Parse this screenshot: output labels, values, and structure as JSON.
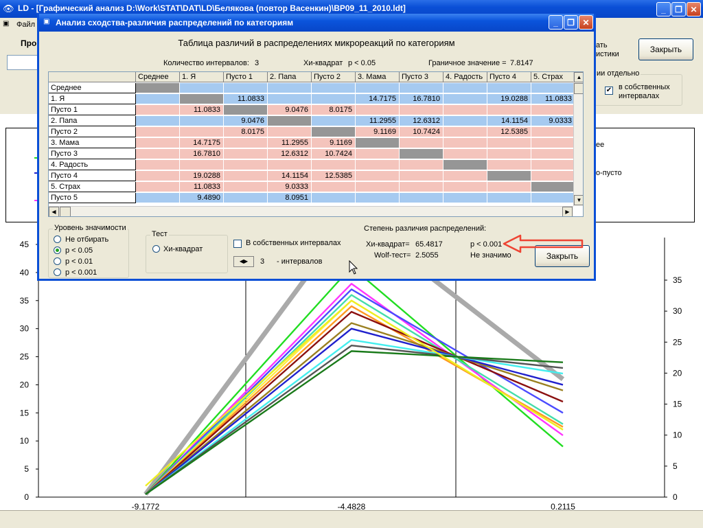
{
  "main": {
    "title": "LD - [Графический анализ D:\\Work\\STAT\\DAT\\LD\\Белякова (повтор Васенкин)\\BP09_11_2010.ldt]",
    "menu_file": "Файл",
    "toolbar_label_pro": "Про",
    "btn_stats_line1": "ать",
    "btn_stats_line2": "истики",
    "close_label": "Закрыть",
    "group_label": "ии отдельно",
    "checkbox_label_1": "в собственных",
    "checkbox_label_2": "интервалах",
    "legend_fragment_1": "ее",
    "legend_fragment_2": "о-пусто"
  },
  "dialog": {
    "title": "Анализ сходства-различия распределений по категориям",
    "table_title": "Таблица различий в распределениях микрореакций по категориям",
    "intervals_label": "Количество интервалов:",
    "intervals_value": "3",
    "chi_label": "Хи-квадрат",
    "chi_p": "p < 0.05",
    "boundary_label": "Граничное значение =",
    "boundary_value": "7.8147",
    "columns": [
      "Среднее",
      "1. Я",
      "Пусто 1",
      "2. Папа",
      "Пусто 2",
      "3. Мама",
      "Пусто 3",
      "4. Радость",
      "Пусто 4",
      "5. Страх"
    ],
    "rows": [
      {
        "label": "Среднее",
        "cells": [
          "",
          "",
          "",
          "",
          "",
          "",
          "",
          "",
          "",
          ""
        ]
      },
      {
        "label": "1. Я",
        "cells": [
          "",
          "",
          "11.0833",
          "",
          "",
          "14.7175",
          "16.7810",
          "",
          "19.0288",
          "11.0833"
        ]
      },
      {
        "label": "Пусто 1",
        "cells": [
          "",
          "11.0833",
          "",
          "9.0476",
          "8.0175",
          "",
          "",
          "",
          "",
          ""
        ]
      },
      {
        "label": "2. Папа",
        "cells": [
          "",
          "",
          "9.0476",
          "",
          "",
          "11.2955",
          "12.6312",
          "",
          "14.1154",
          "9.0333"
        ]
      },
      {
        "label": "Пусто 2",
        "cells": [
          "",
          "",
          "8.0175",
          "",
          "",
          "9.1169",
          "10.7424",
          "",
          "12.5385",
          ""
        ]
      },
      {
        "label": "3. Мама",
        "cells": [
          "",
          "14.7175",
          "",
          "11.2955",
          "9.1169",
          "",
          "",
          "",
          "",
          ""
        ]
      },
      {
        "label": "Пусто 3",
        "cells": [
          "",
          "16.7810",
          "",
          "12.6312",
          "10.7424",
          "",
          "",
          "",
          "",
          ""
        ]
      },
      {
        "label": "4. Радость",
        "cells": [
          "",
          "",
          "",
          "",
          "",
          "",
          "",
          "",
          "",
          ""
        ]
      },
      {
        "label": "Пусто 4",
        "cells": [
          "",
          "19.0288",
          "",
          "14.1154",
          "12.5385",
          "",
          "",
          "",
          "",
          ""
        ]
      },
      {
        "label": "5. Страх",
        "cells": [
          "",
          "11.0833",
          "",
          "9.0333",
          "",
          "",
          "",
          "",
          "",
          ""
        ]
      },
      {
        "label": "Пусто 5",
        "cells": [
          "",
          "9.4890",
          "",
          "8.0951",
          "",
          "",
          "",
          "",
          "",
          ""
        ]
      }
    ],
    "colors": {
      "blue": "#a6caf0",
      "pink": "#f4c4bc",
      "gray": "#969696"
    },
    "significance": {
      "label": "Уровень значимости",
      "options": [
        "Не отбирать",
        "p < 0.05",
        "p < 0.01",
        "p < 0.001"
      ],
      "selected": "p < 0.05"
    },
    "test": {
      "label": "Тест",
      "option": "Хи-квадрат"
    },
    "own_intervals_label": "В собственных интервалах",
    "intervals_stepper_value": "3",
    "intervals_stepper_suffix": "- интервалов",
    "result": {
      "heading": "Степень различия распределений:",
      "chi_label": "Хи-квадрат=",
      "chi_value": "65.4817",
      "chi_p": "p < 0.001",
      "wolf_label": "Wolf-тест=",
      "wolf_value": "2.5055",
      "wolf_p": "Не значимо"
    },
    "close_label": "Закрыть"
  },
  "chart_data": {
    "type": "line",
    "x": [
      -9.1772,
      -4.4828,
      0.2115
    ],
    "x_tick_labels": [
      "-9.1772",
      "-4.4828",
      "0.2115"
    ],
    "y_left_ticks": [
      0,
      5,
      10,
      15,
      20,
      25,
      30,
      35,
      40,
      45
    ],
    "y_right_ticks": [
      0,
      5,
      10,
      15,
      20,
      25,
      30,
      35
    ],
    "ylim_left": [
      0,
      45
    ],
    "ylim_right": [
      0,
      35
    ],
    "series": [
      {
        "color": "#aaaaaa",
        "values": [
          0.5,
          50,
          21
        ]
      },
      {
        "color": "#22dd22",
        "values": [
          0.5,
          41,
          9
        ]
      },
      {
        "color": "#ff33ff",
        "values": [
          0.5,
          38,
          11
        ]
      },
      {
        "color": "#4b4bff",
        "values": [
          0.5,
          37,
          15
        ]
      },
      {
        "color": "#44ddaa",
        "values": [
          0.5,
          36,
          13
        ]
      },
      {
        "color": "#ffee44",
        "values": [
          0.5,
          35,
          12
        ]
      },
      {
        "color": "#ff9922",
        "values": [
          0.5,
          34,
          12.5
        ]
      },
      {
        "color": "#8b1010",
        "values": [
          0.5,
          33,
          17
        ]
      },
      {
        "color": "#9a8020",
        "values": [
          0.5,
          31,
          19
        ]
      },
      {
        "color": "#2020cc",
        "values": [
          0.5,
          30,
          20
        ]
      },
      {
        "color": "#44eeee",
        "values": [
          0.5,
          28,
          22
        ]
      },
      {
        "color": "#555555",
        "values": [
          0.5,
          27,
          23
        ]
      },
      {
        "color": "#1a7a1a",
        "values": [
          0.5,
          26,
          24
        ]
      },
      {
        "color": "#eeee22",
        "values": [
          2,
          35,
          12
        ]
      }
    ]
  }
}
